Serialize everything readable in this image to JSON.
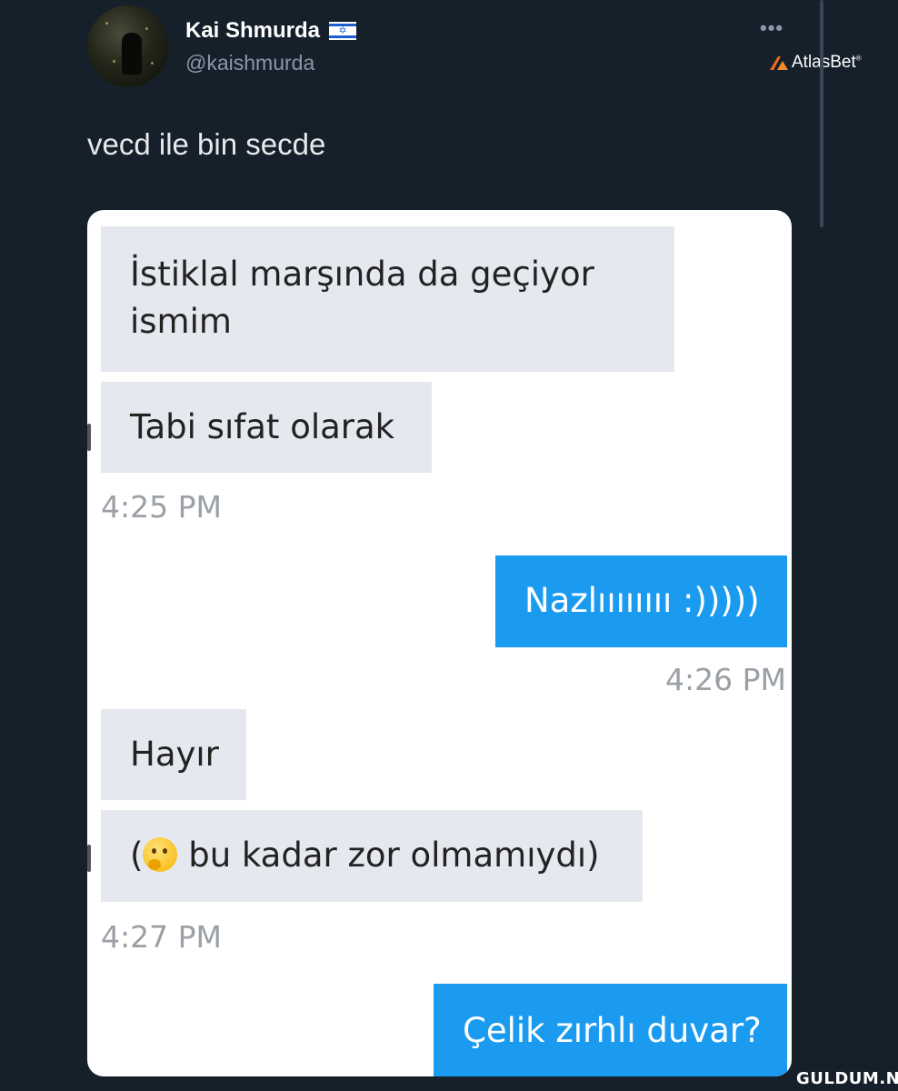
{
  "tweet": {
    "display_name": "Kai Shmurda",
    "handle": "@kaishmurda",
    "text": "vecd ile bin secde",
    "more_label": "•••"
  },
  "brand": {
    "atlas": "AtlasBet",
    "atlas_mark": "®",
    "watermark": "GULDUM.NET"
  },
  "chat": {
    "messages": [
      {
        "dir": "in",
        "line1": "İstiklal marşında da geçiyor",
        "line2": "ismim"
      },
      {
        "dir": "in",
        "text": "Tabi sıfat olarak"
      },
      {
        "time": "4:25 PM"
      },
      {
        "dir": "out",
        "text": "Nazlıııııııı :)))))"
      },
      {
        "time": "4:26 PM"
      },
      {
        "dir": "in",
        "text": "Hayır"
      },
      {
        "dir": "in",
        "open": "(",
        "text": "bu kadar zor olmamıydı)"
      },
      {
        "time": "4:27 PM"
      },
      {
        "dir": "out",
        "text": "Çelik zırhlı duvar?"
      }
    ]
  }
}
